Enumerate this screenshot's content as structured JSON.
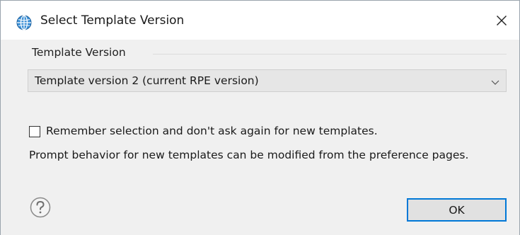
{
  "window": {
    "title": "Select Template Version",
    "title_icon": "globe-icon",
    "close_icon": "close-icon"
  },
  "template_version": {
    "group_label": "Template Version",
    "selected_value": "Template version 2 (current RPE version)",
    "dropdown_icon": "chevron-down-icon"
  },
  "remember": {
    "label": "Remember selection and don't ask again for new templates.",
    "checked": false
  },
  "info": {
    "text": "Prompt behavior for new templates can be modified from the preference pages."
  },
  "footer": {
    "help_icon": "help-icon",
    "ok_label": "OK"
  },
  "colors": {
    "ok_border": "#0078d7",
    "dialog_bg": "#f0f0f0",
    "combo_bg": "#e6e6e6"
  }
}
